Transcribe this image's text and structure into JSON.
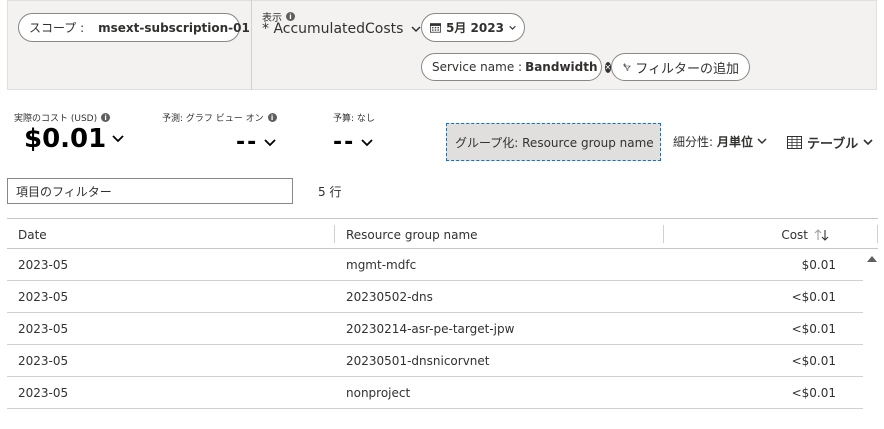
{
  "topbar": {
    "scope_label": "スコープ :",
    "scope_value": "msext-subscription-01",
    "view_label": "表示",
    "view_value": "* AccumulatedCosts",
    "date_value": "5月 2023",
    "filter_name": "Service name :",
    "filter_value": "Bandwidth",
    "add_filter": "フィルターの追加"
  },
  "metrics": {
    "actual_label": "実際のコスト (USD)",
    "actual_value": "$0.01",
    "forecast_label": "予測: グラフ ビュー オン",
    "forecast_value": "--",
    "budget_label": "予算: なし",
    "budget_value": "--"
  },
  "controls": {
    "groupby_label": "グループ化: Resource group name",
    "granularity_label": "細分性:",
    "granularity_value": "月単位",
    "view_type": "テーブル",
    "filter_placeholder": "項目のフィルター",
    "row_count": "5 行"
  },
  "table": {
    "headers": [
      "Date",
      "Resource group name",
      "Cost"
    ],
    "rows": [
      [
        "2023-05",
        "mgmt-mdfc",
        "$0.01"
      ],
      [
        "2023-05",
        "20230502-dns",
        "<$0.01"
      ],
      [
        "2023-05",
        "20230214-asr-pe-target-jpw",
        "<$0.01"
      ],
      [
        "2023-05",
        "20230501-dnsnicorvnet",
        "<$0.01"
      ],
      [
        "2023-05",
        "nonproject",
        "<$0.01"
      ]
    ]
  }
}
